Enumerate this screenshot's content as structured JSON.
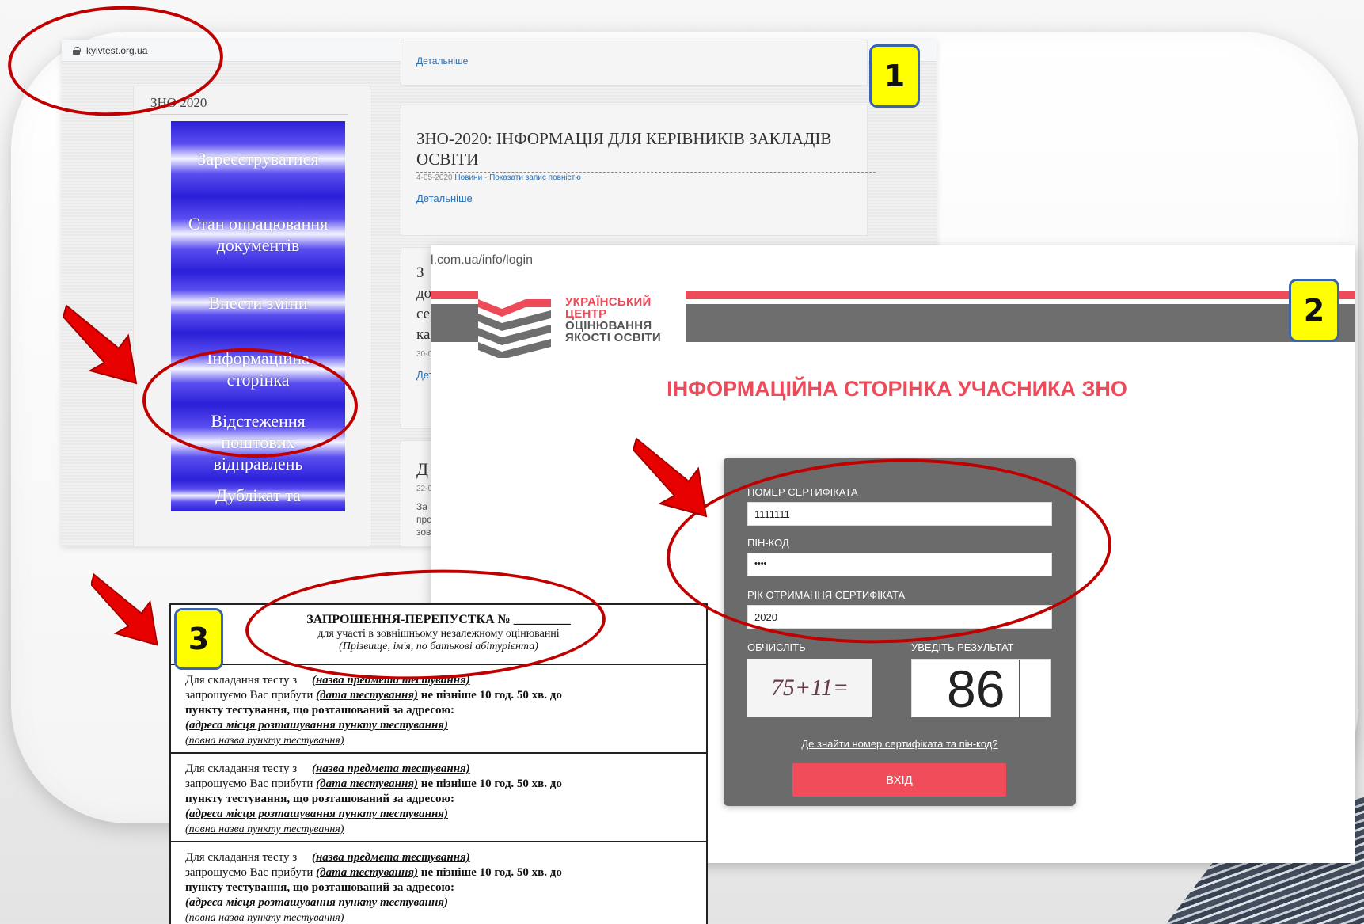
{
  "screenshot1": {
    "badge": "1",
    "url": "kyivtest.org.ua",
    "sidebar_heading": "ЗНО 2020",
    "menu": [
      {
        "label": "Зареєструватися"
      },
      {
        "label": "Стан опрацювання документів"
      },
      {
        "label": "Внести зміни"
      },
      {
        "label": "Інформаційна сторінка"
      },
      {
        "label": "Відстеження поштових відправлень"
      },
      {
        "label": "Дублікат та"
      }
    ],
    "top_more": "Детальніше",
    "news_title": "ЗНО-2020: ІНФОРМАЦІЯ ДЛЯ КЕРІВНИКІВ ЗАКЛАДІВ ОСВІТИ",
    "news_date": "4-05-2020",
    "news_category": "Новини",
    "news_separator": " - ",
    "news_show_all": "Показати запис повністю",
    "news_more": "Детальніше",
    "peek2_lines": [
      "З",
      "до",
      "се",
      "ка"
    ],
    "peek2_date": "30-0",
    "peek2_more": "Дет",
    "peek3_title": "Д",
    "peek3_date": "22-0",
    "peek3_lines": [
      "За",
      "про",
      "зов"
    ]
  },
  "screenshot2": {
    "badge": "2",
    "url": "l.com.ua/info/login",
    "logo_lines_red": [
      "УКРАЇНСЬКИЙ",
      "ЦЕНТР"
    ],
    "logo_lines_gray": [
      "ОЦІНЮВАННЯ",
      "ЯКОСТІ ОСВІТИ"
    ],
    "page_title": "ІНФОРМАЦІЙНА СТОРІНКА УЧАСНИКА ЗНО",
    "form": {
      "certificate_label": "НОМЕР СЕРТИФІКАТА",
      "certificate_value": "1111111",
      "pin_label": "ПІН-КОД",
      "pin_value": "••••",
      "year_label": "РІК ОТРИМАННЯ СЕРТИФІКАТА",
      "year_value": "2020",
      "calc_label": "ОБЧИСЛІТЬ",
      "result_label": "УВЕДІТЬ РЕЗУЛЬТАТ",
      "captcha_expression": "75+11=",
      "captcha_answer": "86",
      "help_link": "Де знайти номер сертифіката та пін-код?",
      "login_button": "ВХІД"
    },
    "accent_color": "#ee4b5a",
    "panel_color": "#6b6b6b"
  },
  "screenshot3": {
    "badge": "3",
    "title": "ЗАПРОШЕННЯ-ПЕРЕПУСТКА № _________",
    "subtitle": "для участі в зовнішньому незалежному оцінюванні",
    "subtitle2": "(Прізвище, ім'я, по батькові абітурієнта)",
    "blocks": [
      {
        "line1_prefix": "Для складання тесту з",
        "subject": "(назва предмета тестування)",
        "line2_prefix": "запрошуємо Вас прибути",
        "date": "(дата тестування)",
        "line2_suffix": "не пізніше 10 год. 50 хв. до",
        "line3": "пункту тестування, що розташований за адресою:",
        "address": "(адреса місця розташування пункту тестування)",
        "point_name": "(повна назва пункту тестування)"
      },
      {
        "line1_prefix": "Для складання тесту з",
        "subject": "(назва предмета тестування)",
        "line2_prefix": "запрошуємо Вас прибути",
        "date": "(дата тестування)",
        "line2_suffix": "не пізніше 10 год. 50 хв. до",
        "line3": "пункту тестування, що розташований за адресою:",
        "address": "(адреса місця розташування пункту тестування)",
        "point_name": "(повна назва пункту тестування)"
      },
      {
        "line1_prefix": "Для складання тесту з",
        "subject": "(назва предмета тестування)",
        "line2_prefix": "запрошуємо Вас прибути",
        "date": "(дата тестування)",
        "line2_suffix": "не пізніше 10 год. 50 хв. до",
        "line3": "пункту тестування, що розташований за адресою:",
        "address": "(адреса місця розташування пункту тестування)",
        "point_name": "(повна назва пункту тестування)"
      }
    ]
  },
  "annotation_color": "#c00000"
}
